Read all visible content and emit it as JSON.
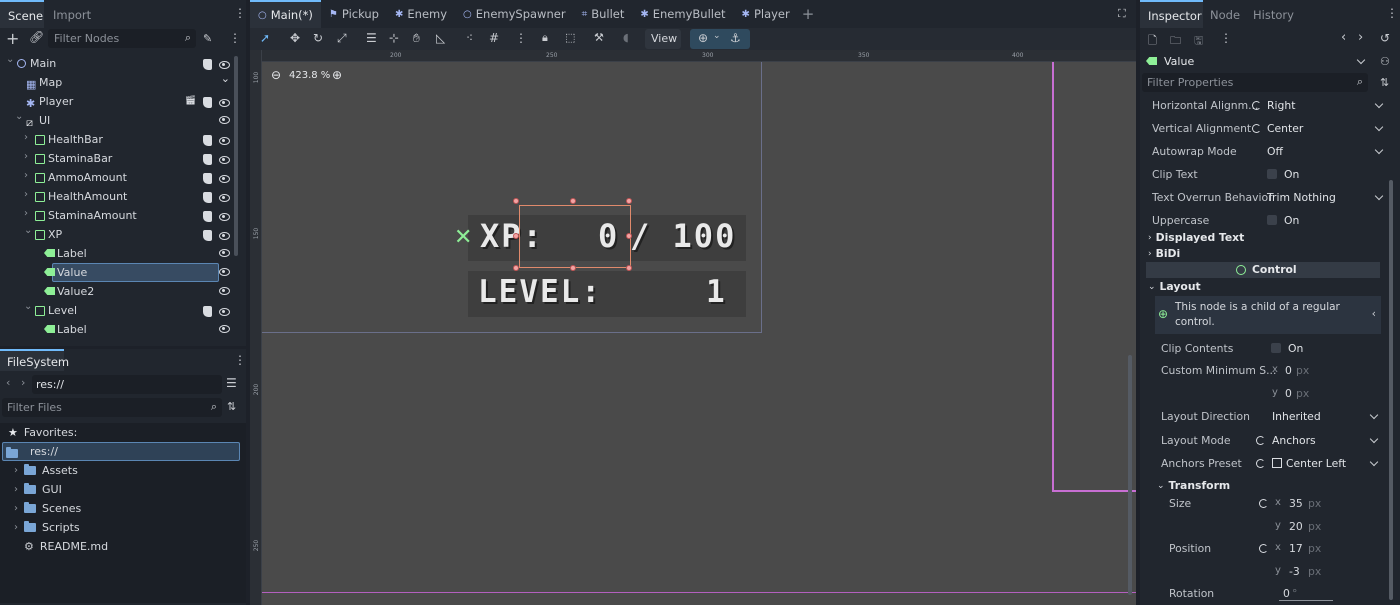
{
  "scene_dock": {
    "tabs": [
      "Scene",
      "Import"
    ],
    "filter_placeholder": "Filter Nodes",
    "tree": [
      {
        "name": "Main",
        "icon": "node2d-icon",
        "depth": 0,
        "arrow": "open"
      },
      {
        "name": "Map",
        "icon": "tilemap-icon",
        "depth": 1,
        "arrow": ""
      },
      {
        "name": "Player",
        "icon": "character-icon",
        "depth": 1,
        "arrow": ""
      },
      {
        "name": "UI",
        "icon": "canvaslayer-icon",
        "depth": 1,
        "arrow": "open"
      },
      {
        "name": "HealthBar",
        "icon": "control-icon",
        "depth": 2,
        "arrow": "closed"
      },
      {
        "name": "StaminaBar",
        "icon": "control-icon",
        "depth": 2,
        "arrow": "closed"
      },
      {
        "name": "AmmoAmount",
        "icon": "control-icon",
        "depth": 2,
        "arrow": "closed"
      },
      {
        "name": "HealthAmount",
        "icon": "control-icon",
        "depth": 2,
        "arrow": "closed"
      },
      {
        "name": "StaminaAmount",
        "icon": "control-icon",
        "depth": 2,
        "arrow": "closed"
      },
      {
        "name": "XP",
        "icon": "control-icon",
        "depth": 2,
        "arrow": "open"
      },
      {
        "name": "Label",
        "icon": "label-icon",
        "depth": 3,
        "arrow": ""
      },
      {
        "name": "Value",
        "icon": "label-icon",
        "depth": 3,
        "arrow": "",
        "selected": true
      },
      {
        "name": "Value2",
        "icon": "label-icon",
        "depth": 3,
        "arrow": ""
      },
      {
        "name": "Level",
        "icon": "control-icon",
        "depth": 2,
        "arrow": "open"
      },
      {
        "name": "Label",
        "icon": "label-icon",
        "depth": 3,
        "arrow": ""
      }
    ]
  },
  "filesystem": {
    "title": "FileSystem",
    "path": "res://",
    "filter_placeholder": "Filter Files",
    "favorites_label": "Favorites:",
    "root": "res://",
    "items": [
      "Assets",
      "GUI",
      "Scenes",
      "Scripts"
    ],
    "readme": "README.md"
  },
  "editor_tabs": [
    "Main(*)",
    "Pickup",
    "Enemy",
    "EnemySpawner",
    "Bullet",
    "EnemyBullet",
    "Player"
  ],
  "toolbar": {
    "view_label": "View"
  },
  "viewport": {
    "zoom": "423.8 %",
    "ruler_ticks": [
      "200",
      "250",
      "300",
      "350",
      "400"
    ],
    "ruler_v_ticks": [
      "100",
      "150",
      "200",
      "250"
    ],
    "game_text": {
      "xp_label": "XP:",
      "xp_value": "0",
      "xp_max": "/ 100",
      "level_label": "LEVEL:",
      "level_value": "1"
    }
  },
  "inspector": {
    "tabs": [
      "Inspector",
      "Node",
      "History"
    ],
    "node_name": "Value",
    "filter_placeholder": "Filter Properties",
    "props": [
      {
        "k": "Horizontal Alignm...",
        "v": "Right",
        "reset": true,
        "dropdown": true
      },
      {
        "k": "Vertical Alignment",
        "v": "Center",
        "reset": true,
        "dropdown": true
      },
      {
        "k": "Autowrap Mode",
        "v": "Off",
        "dropdown": true
      },
      {
        "k": "Clip Text",
        "v": "On",
        "checkbox": true
      },
      {
        "k": "Text Overrun Behavior",
        "v": "Trim Nothing",
        "dropdown": true
      },
      {
        "k": "Uppercase",
        "v": "On",
        "checkbox": true
      }
    ],
    "sections": {
      "displayed_text": "Displayed Text",
      "bidi": "BiDi",
      "control": "Control",
      "layout": "Layout",
      "transform": "Transform"
    },
    "layout_note": "This node is a child of a regular control.",
    "layout_props": {
      "clip_contents": {
        "k": "Clip Contents",
        "v": "On"
      },
      "custom_min": {
        "k": "Custom Minimum S...",
        "x": "0",
        "y": "0",
        "unit": "px"
      },
      "layout_direction": {
        "k": "Layout Direction",
        "v": "Inherited"
      },
      "layout_mode": {
        "k": "Layout Mode",
        "v": "Anchors"
      },
      "anchors_preset": {
        "k": "Anchors Preset",
        "v": "Center Left"
      }
    },
    "transform": {
      "size": {
        "k": "Size",
        "x": "35",
        "y": "20",
        "unit": "px"
      },
      "position": {
        "k": "Position",
        "x": "17",
        "y": "-3",
        "unit": "px"
      },
      "rotation": {
        "k": "Rotation",
        "v": "0",
        "unit": "°"
      }
    }
  }
}
